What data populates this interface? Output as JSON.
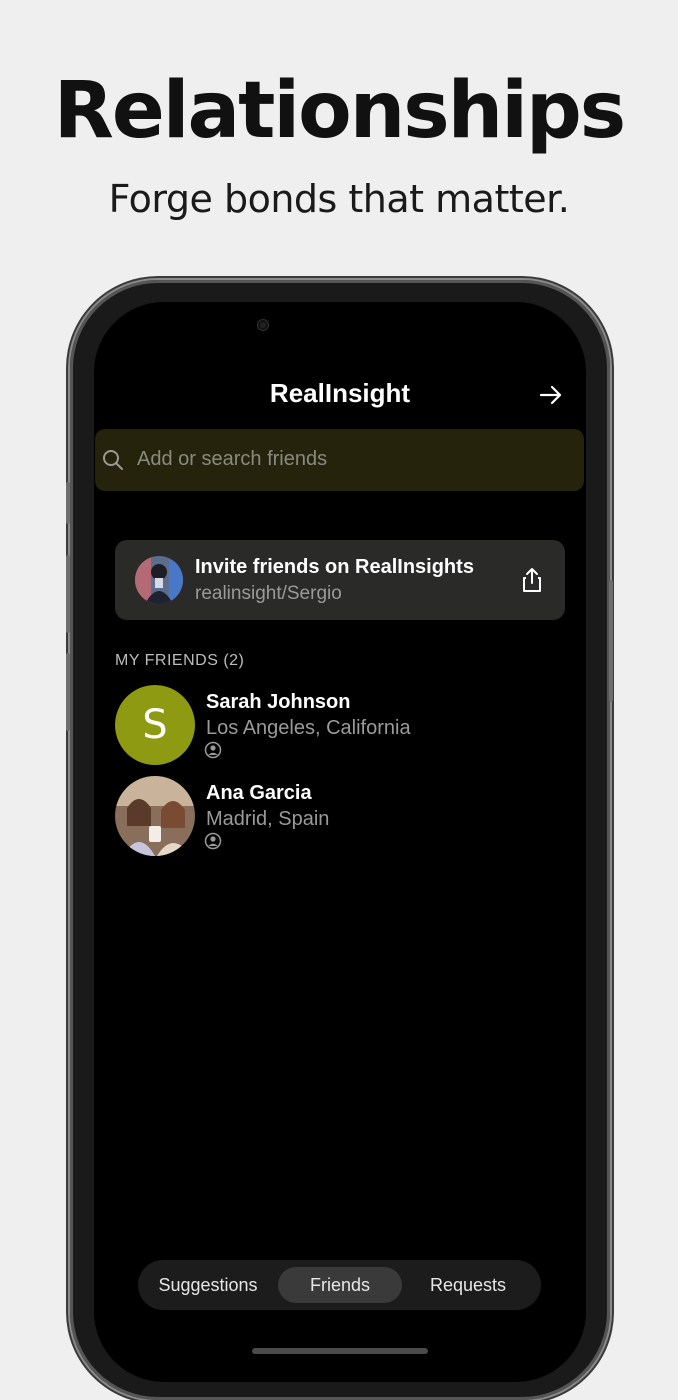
{
  "headline": "Relationships",
  "subline": "Forge bonds that matter.",
  "app": {
    "title": "RealInsight",
    "next_icon": "arrow-right-icon"
  },
  "search": {
    "placeholder": "Add or search friends",
    "icon": "search-icon"
  },
  "invite": {
    "title": "Invite friends on RealInsights",
    "handle": "realinsight/Sergio",
    "share_icon": "share-icon"
  },
  "friends_section": {
    "label": "MY FRIENDS (2)"
  },
  "friends": [
    {
      "name": "Sarah Johnson",
      "location": "Los Angeles, California",
      "initial": "S",
      "avatar_color": "#8e9a12"
    },
    {
      "name": "Ana Garcia",
      "location": "Madrid, Spain",
      "initial": "",
      "avatar_color": "#b98d6f"
    }
  ],
  "tabs": [
    {
      "label": "Suggestions",
      "active": false
    },
    {
      "label": "Friends",
      "active": true
    },
    {
      "label": "Requests",
      "active": false
    }
  ],
  "colors": {
    "background": "#efefef",
    "screen": "#000000",
    "search_bg": "#25230c",
    "card_bg": "#2a2a28",
    "accent": "#8e9a12"
  }
}
